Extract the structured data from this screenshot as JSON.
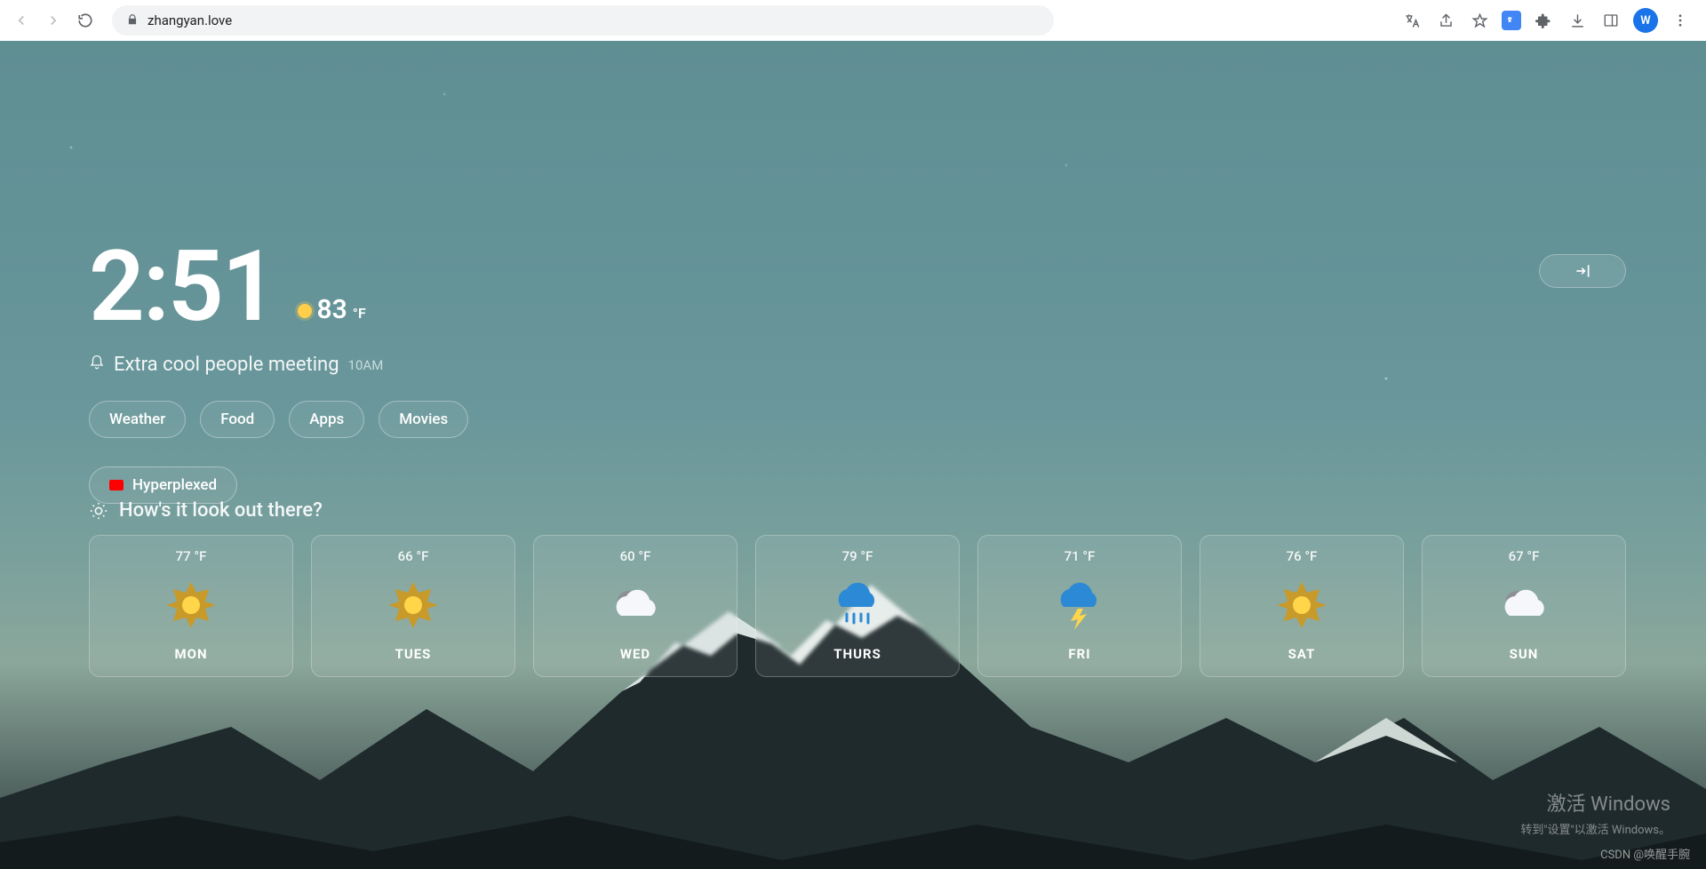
{
  "browser": {
    "url": "zhangyan.love",
    "avatar_initial": "W"
  },
  "dashboard": {
    "clock": "2:51",
    "current_temp_value": "83",
    "current_temp_unit": "°F",
    "reminder_text": "Extra cool people meeting",
    "reminder_time": "10AM",
    "pills": [
      {
        "label": "Weather"
      },
      {
        "label": "Food"
      },
      {
        "label": "Apps"
      },
      {
        "label": "Movies"
      }
    ],
    "link_pill": {
      "label": "Hyperplexed"
    },
    "section_title": "How's it look out there?",
    "forecast": [
      {
        "temp": "77 °F",
        "day": "MON",
        "icon": "sunny"
      },
      {
        "temp": "66 °F",
        "day": "TUES",
        "icon": "sunny"
      },
      {
        "temp": "60 °F",
        "day": "WED",
        "icon": "cloudy"
      },
      {
        "temp": "79 °F",
        "day": "THURS",
        "icon": "rain"
      },
      {
        "temp": "71 °F",
        "day": "FRI",
        "icon": "storm"
      },
      {
        "temp": "76 °F",
        "day": "SAT",
        "icon": "sunny"
      },
      {
        "temp": "67 °F",
        "day": "SUN",
        "icon": "cloudy"
      }
    ]
  },
  "watermark": {
    "windows_line1": "激活 Windows",
    "windows_line2": "转到\"设置\"以激活 Windows。",
    "csdn": "CSDN @唤醒手腕"
  }
}
